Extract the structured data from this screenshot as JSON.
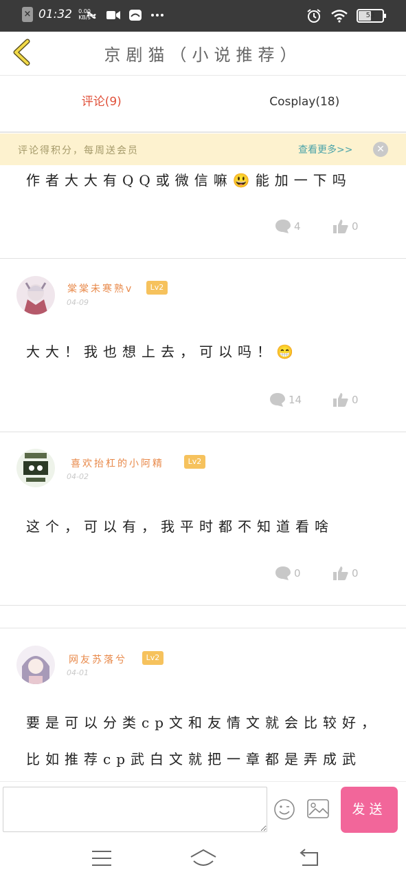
{
  "status_bar": {
    "time": "01:32",
    "net_speed": "0.00",
    "net_unit": "KB/s",
    "battery": "53",
    "battery_level": 0.53
  },
  "header": {
    "title": "京剧猫（小说推荐）"
  },
  "tabs": [
    {
      "label": "评论(9)",
      "active": true
    },
    {
      "label": "Cosplay(18)",
      "active": false
    }
  ],
  "banner": {
    "text": "评论得积分，每周送会员",
    "more": "查看更多>>",
    "close": "✕"
  },
  "comments": [
    {
      "user": "",
      "level": "",
      "date": "",
      "lines": [
        "作者大大有QQ或微信嘛😃能加一下吗"
      ],
      "reply_count": "4",
      "like_count": "0"
    },
    {
      "user": "棠棠未寒熟v",
      "level": "Lv2",
      "date": "04-09",
      "lines": [
        "大大！我也想上去，可以吗！😁"
      ],
      "reply_count": "14",
      "like_count": "0"
    },
    {
      "user": "喜欢抬杠的小阿精",
      "level": "Lv2",
      "date": "04-02",
      "lines": [
        "这个，可以有，我平时都不知道看啥"
      ],
      "reply_count": "0",
      "like_count": "0"
    },
    {
      "user": "网友苏落兮",
      "level": "Lv2",
      "date": "04-01",
      "lines": [
        "要是可以分类cp文和友情文就会比较好，",
        "比如推荐cp武白文就把一章都是弄成武"
      ],
      "reply_count": "",
      "like_count": ""
    }
  ],
  "input_bar": {
    "placeholder": "",
    "send_label": "发送"
  },
  "colors": {
    "accent_pink": "#f2669a",
    "tab_active": "#e0513a",
    "username": "#e8894a",
    "level_badge": "#f6c25d",
    "banner_bg": "#fdf2cf"
  }
}
